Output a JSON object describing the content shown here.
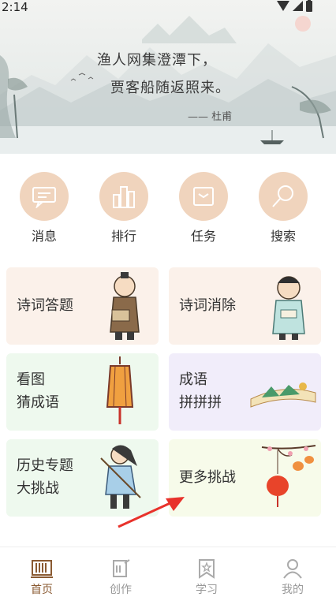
{
  "status_bar": {
    "time": "2:14"
  },
  "banner": {
    "line1": "渔人网集澄潭下，",
    "line2": "贾客船随返照来。",
    "author": "—— 杜甫"
  },
  "menu": [
    {
      "label": "消息",
      "icon": "message-icon"
    },
    {
      "label": "排行",
      "icon": "ranking-icon"
    },
    {
      "label": "任务",
      "icon": "task-icon"
    },
    {
      "label": "搜索",
      "icon": "search-icon"
    }
  ],
  "cards": [
    {
      "line1": "诗词答题",
      "line2": ""
    },
    {
      "line1": "诗词消除",
      "line2": ""
    },
    {
      "line1": "看图",
      "line2": "猜成语"
    },
    {
      "line1": "成语",
      "line2": "拼拼拼"
    },
    {
      "line1": "历史专题",
      "line2": "大挑战"
    },
    {
      "line1": "更多挑战",
      "line2": ""
    }
  ],
  "tabbar": [
    {
      "label": "首页",
      "active": true
    },
    {
      "label": "创作",
      "active": false
    },
    {
      "label": "学习",
      "active": false
    },
    {
      "label": "我的",
      "active": false
    }
  ],
  "colors": {
    "accent": "#8a5a32",
    "menu_circle": "#f0d4bd",
    "card_peach": "#fbf1ea",
    "card_green": "#eef9ee",
    "card_purple": "#f1edfa",
    "card_lime": "#f7fbea",
    "arrow": "#e8322b"
  }
}
